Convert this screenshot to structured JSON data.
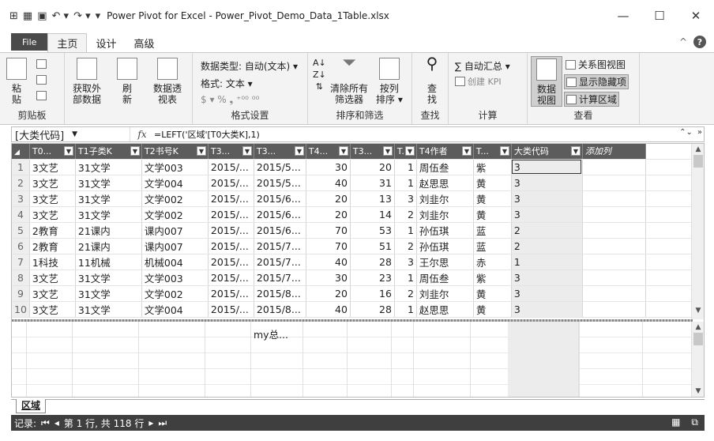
{
  "window": {
    "title": "Power Pivot for Excel - Power_Pivot_Demo_Data_1Table.xlsx",
    "minimize": "—",
    "maximize": "☐",
    "close": "✕"
  },
  "tabs": {
    "file": "File",
    "home": "主页",
    "design": "设计",
    "advanced": "高级",
    "collapse": "^",
    "help": "?"
  },
  "ribbon": {
    "clipboard": {
      "label": "剪贴板",
      "paste": "粘\n贴"
    },
    "get_external": "获取外\n部数据",
    "refresh": "刷\n新",
    "pivot": "数据透\n视表",
    "format": {
      "label": "格式设置",
      "data_type": "数据类型: 自动(文本) ▾",
      "format": "格式: 文本 ▾",
      "symbols": "$ ▾ % ❟ ⁺⁰⁰ ⁰⁰"
    },
    "sort_filter": {
      "label": "排序和筛选",
      "clear": "清除所有\n筛选器",
      "sort_by_col": "按列\n排序 ▾"
    },
    "find": {
      "label": "查找",
      "find": "查\n找"
    },
    "calc": {
      "label": "计算",
      "autosum": "∑ 自动汇总 ▾",
      "create_kpi": "创建 KPI"
    },
    "view": {
      "label": "查看",
      "data_view": "数据\n视图",
      "diagram_view": "关系图视图",
      "show_hidden": "显示隐藏项",
      "calc_area": "计算区域"
    }
  },
  "formula_bar": {
    "name": "[大类代码]",
    "fx": "fx",
    "formula": "=LEFT('区域'[T0大类K],1)"
  },
  "grid": {
    "headers": [
      "T0...",
      "T1子类K",
      "T2书号K",
      "T3...",
      "T3...",
      "T4...",
      "T3...",
      "T...",
      "T4作者",
      "T...",
      "大类代码",
      "添加列"
    ],
    "rows": [
      [
        "1",
        "3文艺",
        "31文学",
        "文学003",
        "2015/...",
        "2015/5...",
        "30",
        "20",
        "1",
        "周伍叁",
        "紫",
        "3"
      ],
      [
        "2",
        "3文艺",
        "31文学",
        "文学004",
        "2015/...",
        "2015/5...",
        "40",
        "31",
        "1",
        "赵思思",
        "黄",
        "3"
      ],
      [
        "3",
        "3文艺",
        "31文学",
        "文学002",
        "2015/...",
        "2015/6...",
        "20",
        "13",
        "3",
        "刘韭尔",
        "黄",
        "3"
      ],
      [
        "4",
        "3文艺",
        "31文学",
        "文学002",
        "2015/...",
        "2015/6...",
        "20",
        "14",
        "2",
        "刘韭尔",
        "黄",
        "3"
      ],
      [
        "5",
        "2教育",
        "21课内",
        "课内007",
        "2015/...",
        "2015/6...",
        "70",
        "53",
        "1",
        "孙伍琪",
        "蓝",
        "2"
      ],
      [
        "6",
        "2教育",
        "21课内",
        "课内007",
        "2015/...",
        "2015/7...",
        "70",
        "51",
        "2",
        "孙伍琪",
        "蓝",
        "2"
      ],
      [
        "7",
        "1科技",
        "11机械",
        "机械004",
        "2015/...",
        "2015/7...",
        "40",
        "28",
        "3",
        "王尔思",
        "赤",
        "1"
      ],
      [
        "8",
        "3文艺",
        "31文学",
        "文学003",
        "2015/...",
        "2015/7...",
        "30",
        "23",
        "1",
        "周伍叁",
        "紫",
        "3"
      ],
      [
        "9",
        "3文艺",
        "31文学",
        "文学002",
        "2015/...",
        "2015/8...",
        "20",
        "16",
        "2",
        "刘韭尔",
        "黄",
        "3"
      ],
      [
        "10",
        "3文艺",
        "31文学",
        "文学004",
        "2015/...",
        "2015/8...",
        "40",
        "28",
        "1",
        "赵思思",
        "黄",
        "3"
      ]
    ],
    "measure": "my总...",
    "sheet_tab": "区域"
  },
  "status": {
    "record": "记录:",
    "first": "⏮",
    "prev": "◂",
    "position": "第 1 行, 共 118 行",
    "next": "▸",
    "last": "⏭",
    "grid_icon": "▦",
    "diagram_icon": "⧉"
  }
}
